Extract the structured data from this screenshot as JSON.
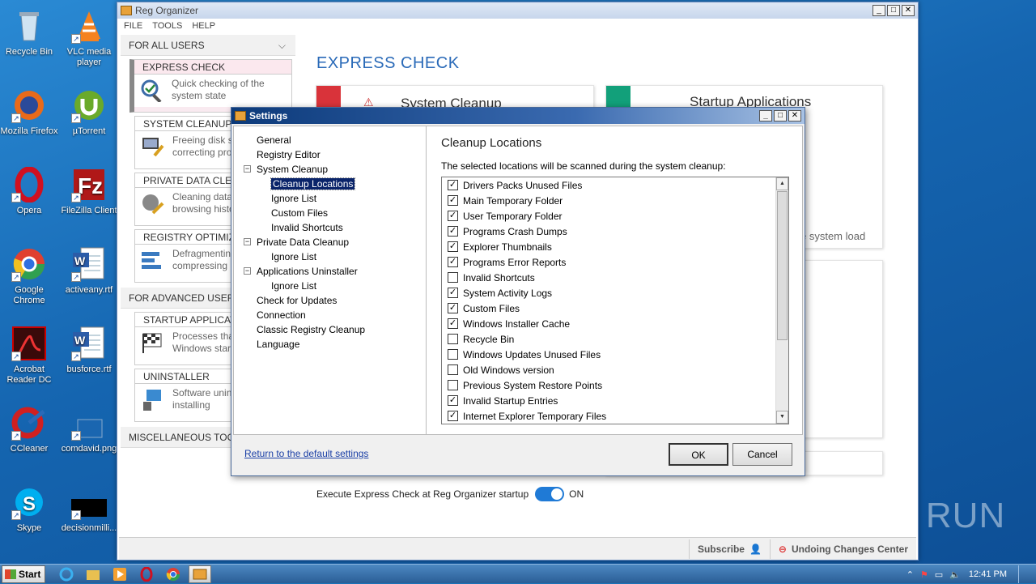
{
  "desktop": {
    "icons": [
      {
        "label": "Recycle Bin",
        "name": "recycle-bin-icon"
      },
      {
        "label": "VLC media player",
        "name": "vlc-icon"
      },
      {
        "label": "Mozilla Firefox",
        "name": "firefox-icon"
      },
      {
        "label": "µTorrent",
        "name": "utorrent-icon"
      },
      {
        "label": "Opera",
        "name": "opera-icon"
      },
      {
        "label": "FileZilla Client",
        "name": "filezilla-icon"
      },
      {
        "label": "Google Chrome",
        "name": "chrome-icon"
      },
      {
        "label": "activeany.rtf",
        "name": "word-document-icon"
      },
      {
        "label": "Acrobat Reader DC",
        "name": "acrobat-icon"
      },
      {
        "label": "busforce.rtf",
        "name": "word-document-icon"
      },
      {
        "label": "CCleaner",
        "name": "ccleaner-icon"
      },
      {
        "label": "comdavid.png",
        "name": "image-file-icon"
      },
      {
        "label": "Skype",
        "name": "skype-icon"
      },
      {
        "label": "decisionmilli...",
        "name": "black-file-icon"
      }
    ],
    "watermark": "ANY RUN"
  },
  "reg": {
    "title": "Reg Organizer",
    "menu": [
      "FILE",
      "TOOLS",
      "HELP"
    ],
    "for_all_users": "FOR ALL USERS",
    "for_advanced": "FOR ADVANCED USERS",
    "misc": "MISCELLANEOUS TOOLS",
    "blocks": [
      {
        "head": "EXPRESS CHECK",
        "body": "Quick checking of the system state"
      },
      {
        "head": "SYSTEM CLEANUP",
        "body": "Freeing disk space and correcting problems"
      },
      {
        "head": "PRIVATE DATA CLEANUP",
        "body": "Cleaning data on browsing history"
      },
      {
        "head": "REGISTRY OPTIMIZATION",
        "body": "Defragmenting and compressing"
      }
    ],
    "adv_blocks": [
      {
        "head": "STARTUP APPLICATIONS",
        "body": "Processes that start with Windows startup"
      },
      {
        "head": "UNINSTALLER",
        "body": "Software uninstalling and installing"
      }
    ],
    "main_title": "EXPRESS CHECK",
    "card1_title": "System Cleanup",
    "card2_title": "Startup Applications",
    "card2_text": "e system load",
    "exec_label": "Execute Express Check at Reg Organizer startup",
    "toggle_state": "ON",
    "subscribe": "Subscribe",
    "undo_center": "Undoing Changes Center"
  },
  "settings": {
    "title": "Settings",
    "tree": [
      {
        "label": "General",
        "level": 1,
        "expander": ""
      },
      {
        "label": "Registry Editor",
        "level": 1,
        "expander": ""
      },
      {
        "label": "System Cleanup",
        "level": 1,
        "expander": "−"
      },
      {
        "label": "Cleanup Locations",
        "level": 2,
        "expander": "",
        "selected": true
      },
      {
        "label": "Ignore List",
        "level": 2,
        "expander": ""
      },
      {
        "label": "Custom Files",
        "level": 2,
        "expander": ""
      },
      {
        "label": "Invalid Shortcuts",
        "level": 2,
        "expander": ""
      },
      {
        "label": "Private Data Cleanup",
        "level": 1,
        "expander": "−"
      },
      {
        "label": "Ignore List",
        "level": 2,
        "expander": ""
      },
      {
        "label": "Applications Uninstaller",
        "level": 1,
        "expander": "−"
      },
      {
        "label": "Ignore List",
        "level": 2,
        "expander": ""
      },
      {
        "label": "Check for Updates",
        "level": 1,
        "expander": ""
      },
      {
        "label": "Connection",
        "level": 1,
        "expander": ""
      },
      {
        "label": "Classic Registry Cleanup",
        "level": 1,
        "expander": ""
      },
      {
        "label": "Language",
        "level": 1,
        "expander": ""
      }
    ],
    "pane_title": "Cleanup Locations",
    "pane_desc": "The selected locations will be scanned during the system cleanup:",
    "locations": [
      {
        "label": "Drivers Packs Unused Files",
        "checked": true
      },
      {
        "label": "Main Temporary Folder",
        "checked": true
      },
      {
        "label": "User Temporary Folder",
        "checked": true
      },
      {
        "label": "Programs Crash Dumps",
        "checked": true
      },
      {
        "label": "Explorer Thumbnails",
        "checked": true
      },
      {
        "label": "Programs Error Reports",
        "checked": true
      },
      {
        "label": "Invalid Shortcuts",
        "checked": false
      },
      {
        "label": "System Activity Logs",
        "checked": true
      },
      {
        "label": "Custom Files",
        "checked": true
      },
      {
        "label": "Windows Installer Cache",
        "checked": true
      },
      {
        "label": "Recycle Bin",
        "checked": false
      },
      {
        "label": "Windows Updates Unused Files",
        "checked": false
      },
      {
        "label": "Old Windows version",
        "checked": false
      },
      {
        "label": "Previous System Restore Points",
        "checked": false
      },
      {
        "label": "Invalid Startup Entries",
        "checked": true
      },
      {
        "label": "Internet Explorer Temporary Files",
        "checked": true
      }
    ],
    "reset_link": "Return to the default settings",
    "ok": "OK",
    "cancel": "Cancel"
  },
  "taskbar": {
    "start": "Start",
    "clock": "12:41 PM"
  }
}
